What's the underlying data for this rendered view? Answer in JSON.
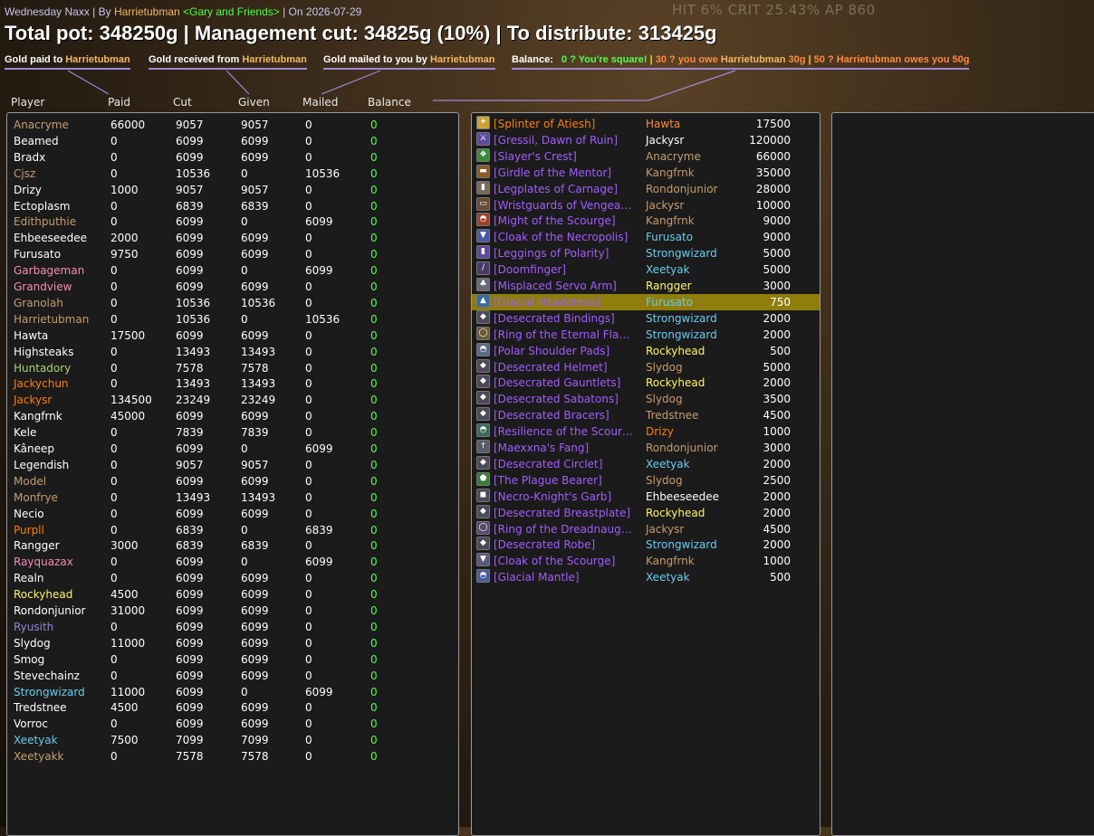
{
  "colors": {
    "accent_line": "#9d8ad6",
    "epic": "#a55cff",
    "legendary": "#ff8000",
    "balance_zero": "#4dff4d",
    "highlight_row": "#8f7d0c"
  },
  "hud_text": "HIT 6%  CRIT 25.43%   AP 860",
  "title": {
    "raid": "Wednesday Naxx",
    "by_label": "| By",
    "author": "Harrietubman",
    "guild": "<Gary and Friends>",
    "date": "| On 2026-07-29"
  },
  "pot_line": "Total pot: 348250g | Management cut: 34825g (10%) | To distribute: 313425g",
  "legend": {
    "paid_prefix": "Gold paid to",
    "paid_name": "Harrietubman",
    "received_prefix": "Gold received from",
    "received_name": "Harrietubman",
    "mailed_prefix": "Gold mailed to you by",
    "mailed_name": "Harrietubman",
    "balance_label": "Balance:",
    "balance_square": "0 ? You're square!",
    "sep1": "|",
    "balance_owe_prefix": "30 ? you owe",
    "balance_owe_name": "Harrietubman",
    "balance_owe_amount": "30g",
    "sep2": "|",
    "balance_owed_prefix": "50 ? Harrietubman owes you 50g"
  },
  "columns": [
    "Player",
    "Paid",
    "Cut",
    "Given",
    "Mailed",
    "Balance"
  ],
  "players": [
    {
      "name": "Anacryme",
      "color": "#c79c6e",
      "paid": "66000",
      "cut": "9057",
      "given": "9057",
      "mailed": "0",
      "balance": "0"
    },
    {
      "name": "Beamed",
      "color": "#ffffff",
      "paid": "0",
      "cut": "6099",
      "given": "6099",
      "mailed": "0",
      "balance": "0"
    },
    {
      "name": "Bradx",
      "color": "#ffffff",
      "paid": "0",
      "cut": "6099",
      "given": "6099",
      "mailed": "0",
      "balance": "0"
    },
    {
      "name": "Cjsz",
      "color": "#c79c6e",
      "paid": "0",
      "cut": "10536",
      "given": "0",
      "mailed": "10536",
      "balance": "0"
    },
    {
      "name": "Drizy",
      "color": "#ffffff",
      "paid": "1000",
      "cut": "9057",
      "given": "9057",
      "mailed": "0",
      "balance": "0"
    },
    {
      "name": "Ectoplasm",
      "color": "#ffffff",
      "paid": "0",
      "cut": "6839",
      "given": "6839",
      "mailed": "0",
      "balance": "0"
    },
    {
      "name": "Edithputhie",
      "color": "#c79c6e",
      "paid": "0",
      "cut": "6099",
      "given": "0",
      "mailed": "6099",
      "balance": "0"
    },
    {
      "name": "Ehbeeseedee",
      "color": "#ffffff",
      "paid": "2000",
      "cut": "6099",
      "given": "6099",
      "mailed": "0",
      "balance": "0"
    },
    {
      "name": "Furusato",
      "color": "#ffffff",
      "paid": "9750",
      "cut": "6099",
      "given": "6099",
      "mailed": "0",
      "balance": "0"
    },
    {
      "name": "Garbageman",
      "color": "#f58cba",
      "paid": "0",
      "cut": "6099",
      "given": "0",
      "mailed": "6099",
      "balance": "0"
    },
    {
      "name": "Grandview",
      "color": "#f58cba",
      "paid": "0",
      "cut": "6099",
      "given": "6099",
      "mailed": "0",
      "balance": "0"
    },
    {
      "name": "Granolah",
      "color": "#c79c6e",
      "paid": "0",
      "cut": "10536",
      "given": "10536",
      "mailed": "0",
      "balance": "0"
    },
    {
      "name": "Harrietubman",
      "color": "#c79c6e",
      "paid": "0",
      "cut": "10536",
      "given": "0",
      "mailed": "10536",
      "balance": "0"
    },
    {
      "name": "Hawta",
      "color": "#ffffff",
      "paid": "17500",
      "cut": "6099",
      "given": "6099",
      "mailed": "0",
      "balance": "0"
    },
    {
      "name": "Highsteaks",
      "color": "#ffffff",
      "paid": "0",
      "cut": "13493",
      "given": "13493",
      "mailed": "0",
      "balance": "0"
    },
    {
      "name": "Huntadory",
      "color": "#abd473",
      "paid": "0",
      "cut": "7578",
      "given": "7578",
      "mailed": "0",
      "balance": "0"
    },
    {
      "name": "Jackychun",
      "color": "#ff7d0a",
      "paid": "0",
      "cut": "13493",
      "given": "13493",
      "mailed": "0",
      "balance": "0"
    },
    {
      "name": "Jackysr",
      "color": "#ff7d0a",
      "paid": "134500",
      "cut": "23249",
      "given": "23249",
      "mailed": "0",
      "balance": "0"
    },
    {
      "name": "Kangfrnk",
      "color": "#ffffff",
      "paid": "45000",
      "cut": "6099",
      "given": "6099",
      "mailed": "0",
      "balance": "0"
    },
    {
      "name": "Kele",
      "color": "#ffffff",
      "paid": "0",
      "cut": "7839",
      "given": "7839",
      "mailed": "0",
      "balance": "0"
    },
    {
      "name": "Kâneep",
      "color": "#ffffff",
      "paid": "0",
      "cut": "6099",
      "given": "0",
      "mailed": "6099",
      "balance": "0"
    },
    {
      "name": "Legendish",
      "color": "#ffffff",
      "paid": "0",
      "cut": "9057",
      "given": "9057",
      "mailed": "0",
      "balance": "0"
    },
    {
      "name": "Model",
      "color": "#c79c6e",
      "paid": "0",
      "cut": "6099",
      "given": "6099",
      "mailed": "0",
      "balance": "0"
    },
    {
      "name": "Monfrye",
      "color": "#c79c6e",
      "paid": "0",
      "cut": "13493",
      "given": "13493",
      "mailed": "0",
      "balance": "0"
    },
    {
      "name": "Necio",
      "color": "#ffffff",
      "paid": "0",
      "cut": "6099",
      "given": "6099",
      "mailed": "0",
      "balance": "0"
    },
    {
      "name": "Purpll",
      "color": "#ff7d0a",
      "paid": "0",
      "cut": "6839",
      "given": "0",
      "mailed": "6839",
      "balance": "0"
    },
    {
      "name": "Rangger",
      "color": "#ffffff",
      "paid": "3000",
      "cut": "6839",
      "given": "6839",
      "mailed": "0",
      "balance": "0"
    },
    {
      "name": "Rayquazax",
      "color": "#f58cba",
      "paid": "0",
      "cut": "6099",
      "given": "0",
      "mailed": "6099",
      "balance": "0"
    },
    {
      "name": "Realn",
      "color": "#ffffff",
      "paid": "0",
      "cut": "6099",
      "given": "6099",
      "mailed": "0",
      "balance": "0"
    },
    {
      "name": "Rockyhead",
      "color": "#fff569",
      "paid": "4500",
      "cut": "6099",
      "given": "6099",
      "mailed": "0",
      "balance": "0"
    },
    {
      "name": "Rondonjunior",
      "color": "#ffffff",
      "paid": "31000",
      "cut": "6099",
      "given": "6099",
      "mailed": "0",
      "balance": "0"
    },
    {
      "name": "Ryusith",
      "color": "#9482c9",
      "paid": "0",
      "cut": "6099",
      "given": "6099",
      "mailed": "0",
      "balance": "0"
    },
    {
      "name": "Slydog",
      "color": "#ffffff",
      "paid": "11000",
      "cut": "6099",
      "given": "6099",
      "mailed": "0",
      "balance": "0"
    },
    {
      "name": "Smog",
      "color": "#ffffff",
      "paid": "0",
      "cut": "6099",
      "given": "6099",
      "mailed": "0",
      "balance": "0"
    },
    {
      "name": "Stevechainz",
      "color": "#ffffff",
      "paid": "0",
      "cut": "6099",
      "given": "6099",
      "mailed": "0",
      "balance": "0"
    },
    {
      "name": "Strongwizard",
      "color": "#69ccf0",
      "paid": "11000",
      "cut": "6099",
      "given": "0",
      "mailed": "6099",
      "balance": "0"
    },
    {
      "name": "Tredstnee",
      "color": "#ffffff",
      "paid": "4500",
      "cut": "6099",
      "given": "6099",
      "mailed": "0",
      "balance": "0"
    },
    {
      "name": "Vorroc",
      "color": "#ffffff",
      "paid": "0",
      "cut": "6099",
      "given": "6099",
      "mailed": "0",
      "balance": "0"
    },
    {
      "name": "Xeetyak",
      "color": "#69ccf0",
      "paid": "7500",
      "cut": "7099",
      "given": "7099",
      "mailed": "0",
      "balance": "0"
    },
    {
      "name": "Xeetyakk",
      "color": "#c79c6e",
      "paid": "0",
      "cut": "7578",
      "given": "7578",
      "mailed": "0",
      "balance": "0"
    }
  ],
  "loot": [
    {
      "item": "[Splinter of Atiesh]",
      "quality": "legendary",
      "icon": "splinter-icon",
      "icon_color": "#c9a23a",
      "winner": "Hawta",
      "winner_color": "#ff8a40",
      "amount": "17500"
    },
    {
      "item": "[Gressil, Dawn of Ruin]",
      "quality": "epic",
      "icon": "sword-icon",
      "icon_color": "#5a4aa0",
      "winner": "Jackysr",
      "winner_color": "#ffffff",
      "amount": "120000"
    },
    {
      "item": "[Slayer's Crest]",
      "quality": "epic",
      "icon": "trinket-icon",
      "icon_color": "#3b8a3b",
      "winner": "Anacryme",
      "winner_color": "#c79c6e",
      "amount": "66000"
    },
    {
      "item": "[Girdle of the Mentor]",
      "quality": "epic",
      "icon": "belt-icon",
      "icon_color": "#8a5a2a",
      "winner": "Kangfrnk",
      "winner_color": "#c79c6e",
      "amount": "35000"
    },
    {
      "item": "[Legplates of Carnage]",
      "quality": "epic",
      "icon": "legs-icon",
      "icon_color": "#7a6a5a",
      "winner": "Rondonjunior",
      "winner_color": "#c79c6e",
      "amount": "28000"
    },
    {
      "item": "[Wristguards of Vengea…",
      "quality": "epic",
      "icon": "bracer-icon",
      "icon_color": "#6a4a3a",
      "winner": "Jackysr",
      "winner_color": "#c79c6e",
      "amount": "10000"
    },
    {
      "item": "[Might of the Scourge]",
      "quality": "epic",
      "icon": "shoulder-icon",
      "icon_color": "#a0402a",
      "winner": "Kangfrnk",
      "winner_color": "#c79c6e",
      "amount": "9000"
    },
    {
      "item": "[Cloak of the Necropolis]",
      "quality": "epic",
      "icon": "cloak-icon",
      "icon_color": "#4a5aa0",
      "winner": "Furusato",
      "winner_color": "#69ccf0",
      "amount": "9000"
    },
    {
      "item": "[Leggings of Polarity]",
      "quality": "epic",
      "icon": "legs-icon",
      "icon_color": "#5a4a9a",
      "winner": "Strongwizard",
      "winner_color": "#69ccf0",
      "amount": "5000"
    },
    {
      "item": "[Doomfinger]",
      "quality": "epic",
      "icon": "wand-icon",
      "icon_color": "#4a3a6a",
      "winner": "Xeetyak",
      "winner_color": "#69ccf0",
      "amount": "5000"
    },
    {
      "item": "[Misplaced Servo Arm]",
      "quality": "epic",
      "icon": "mace-icon",
      "icon_color": "#6a6a7a",
      "winner": "Rangger",
      "winner_color": "#fff569",
      "amount": "3000"
    },
    {
      "item": "[Glacial Headdress]",
      "quality": "epic",
      "icon": "helm-icon",
      "icon_color": "#3a6aa0",
      "winner": "Furusato",
      "winner_color": "#69ccf0",
      "amount": "750",
      "highlight": true
    },
    {
      "item": "[Desecrated Bindings]",
      "quality": "epic",
      "icon": "token-icon",
      "icon_color": "#4a4a5a",
      "winner": "Strongwizard",
      "winner_color": "#69ccf0",
      "amount": "2000"
    },
    {
      "item": "[Ring of the Eternal Fla…",
      "quality": "epic",
      "icon": "ring-icon",
      "icon_color": "#6a5a3a",
      "winner": "Strongwizard",
      "winner_color": "#69ccf0",
      "amount": "2000"
    },
    {
      "item": "[Polar Shoulder Pads]",
      "quality": "epic",
      "icon": "shoulder-icon",
      "icon_color": "#5a6a8a",
      "winner": "Rockyhead",
      "winner_color": "#fff569",
      "amount": "500"
    },
    {
      "item": "[Desecrated Helmet]",
      "quality": "epic",
      "icon": "token-icon",
      "icon_color": "#4a4a5a",
      "winner": "Slydog",
      "winner_color": "#c79c6e",
      "amount": "5000"
    },
    {
      "item": "[Desecrated Gauntlets]",
      "quality": "epic",
      "icon": "token-icon",
      "icon_color": "#4a4a5a",
      "winner": "Rockyhead",
      "winner_color": "#fff569",
      "amount": "2000"
    },
    {
      "item": "[Desecrated Sabatons]",
      "quality": "epic",
      "icon": "token-icon",
      "icon_color": "#4a4a5a",
      "winner": "Slydog",
      "winner_color": "#c79c6e",
      "amount": "3500"
    },
    {
      "item": "[Desecrated Bracers]",
      "quality": "epic",
      "icon": "token-icon",
      "icon_color": "#4a4a5a",
      "winner": "Tredstnee",
      "winner_color": "#c79c6e",
      "amount": "4500"
    },
    {
      "item": "[Resilience of the Scour…",
      "quality": "epic",
      "icon": "shoulder-icon",
      "icon_color": "#3a6a5a",
      "winner": "Drizy",
      "winner_color": "#ff7d0a",
      "amount": "1000"
    },
    {
      "item": "[Maexxna's Fang]",
      "quality": "epic",
      "icon": "dagger-icon",
      "icon_color": "#5a5a6a",
      "winner": "Rondonjunior",
      "winner_color": "#c79c6e",
      "amount": "3000"
    },
    {
      "item": "[Desecrated Circlet]",
      "quality": "epic",
      "icon": "token-icon",
      "icon_color": "#4a4a5a",
      "winner": "Xeetyak",
      "winner_color": "#69ccf0",
      "amount": "2000"
    },
    {
      "item": "[The Plague Bearer]",
      "quality": "epic",
      "icon": "shield-icon",
      "icon_color": "#3a7a3a",
      "winner": "Slydog",
      "winner_color": "#c79c6e",
      "amount": "2500"
    },
    {
      "item": "[Necro-Knight's Garb]",
      "quality": "epic",
      "icon": "robe-icon",
      "icon_color": "#4a4a5a",
      "winner": "Ehbeeseedee",
      "winner_color": "#ffffff",
      "amount": "2000"
    },
    {
      "item": "[Desecrated Breastplate]",
      "quality": "epic",
      "icon": "token-icon",
      "icon_color": "#4a4a5a",
      "winner": "Rockyhead",
      "winner_color": "#fff569",
      "amount": "2000"
    },
    {
      "item": "[Ring of the Dreadnaug…",
      "quality": "epic",
      "icon": "ring-icon",
      "icon_color": "#5a4a6a",
      "winner": "Jackysr",
      "winner_color": "#c79c6e",
      "amount": "4500"
    },
    {
      "item": "[Desecrated Robe]",
      "quality": "epic",
      "icon": "token-icon",
      "icon_color": "#4a4a5a",
      "winner": "Strongwizard",
      "winner_color": "#69ccf0",
      "amount": "2000"
    },
    {
      "item": "[Cloak of the Scourge]",
      "quality": "epic",
      "icon": "cloak-icon",
      "icon_color": "#5a5a7a",
      "winner": "Kangfrnk",
      "winner_color": "#c79c6e",
      "amount": "1000"
    },
    {
      "item": "[Glacial Mantle]",
      "quality": "epic",
      "icon": "shoulder-icon",
      "icon_color": "#4a5a9a",
      "winner": "Xeetyak",
      "winner_color": "#69ccf0",
      "amount": "500"
    }
  ]
}
